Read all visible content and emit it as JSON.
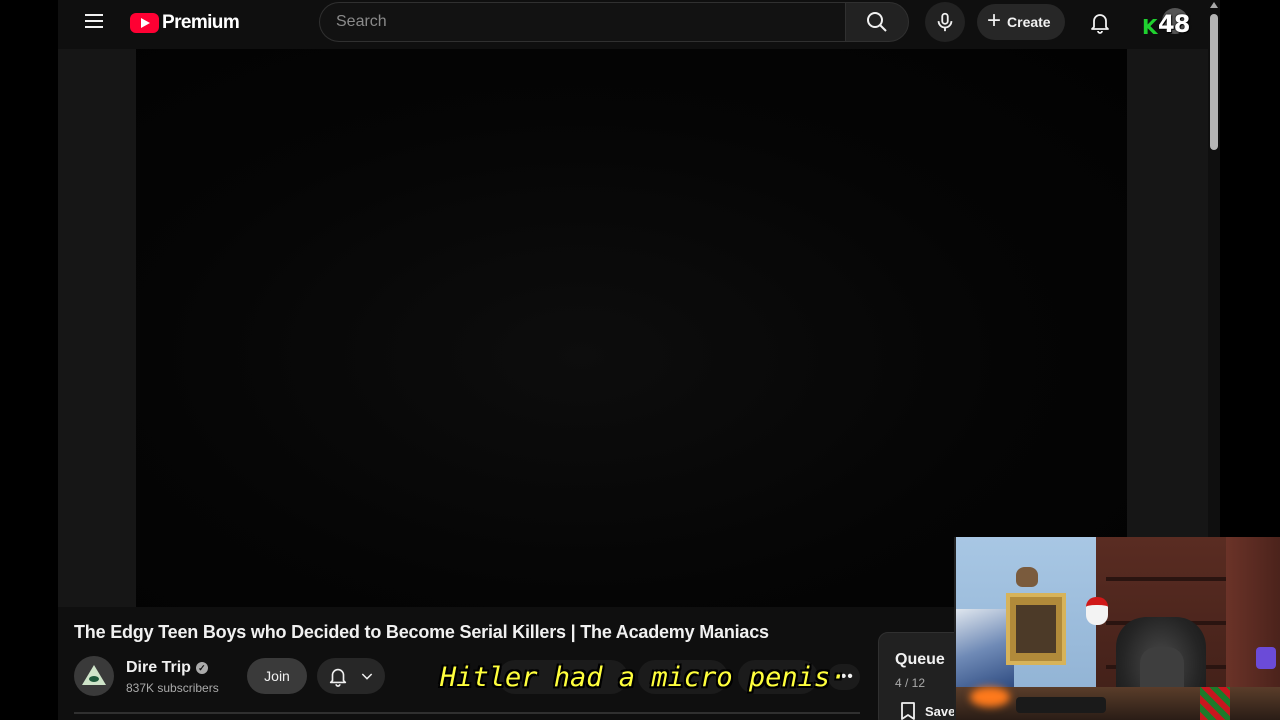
{
  "header": {
    "logo_text": "Premium",
    "search_placeholder": "Search",
    "create_label": "Create",
    "avatar_badge_letter": "K",
    "avatar_badge_number": "48"
  },
  "video": {
    "title": "The Edgy Teen Boys who Decided to Become Serial Killers | The Academy Maniacs",
    "channel_name": "Dire Trip",
    "subscribers": "837K subscribers",
    "join_label": "Join"
  },
  "queue": {
    "title": "Queue",
    "count": "4 / 12",
    "save_label": "Save"
  },
  "overlay": {
    "subtitle": "Hitler had a micro penis·"
  },
  "colors": {
    "background": "#0f0f0f",
    "brand_red": "#ff0033",
    "subtitle_yellow": "#ffff3c",
    "badge_green": "#1fd12f"
  }
}
